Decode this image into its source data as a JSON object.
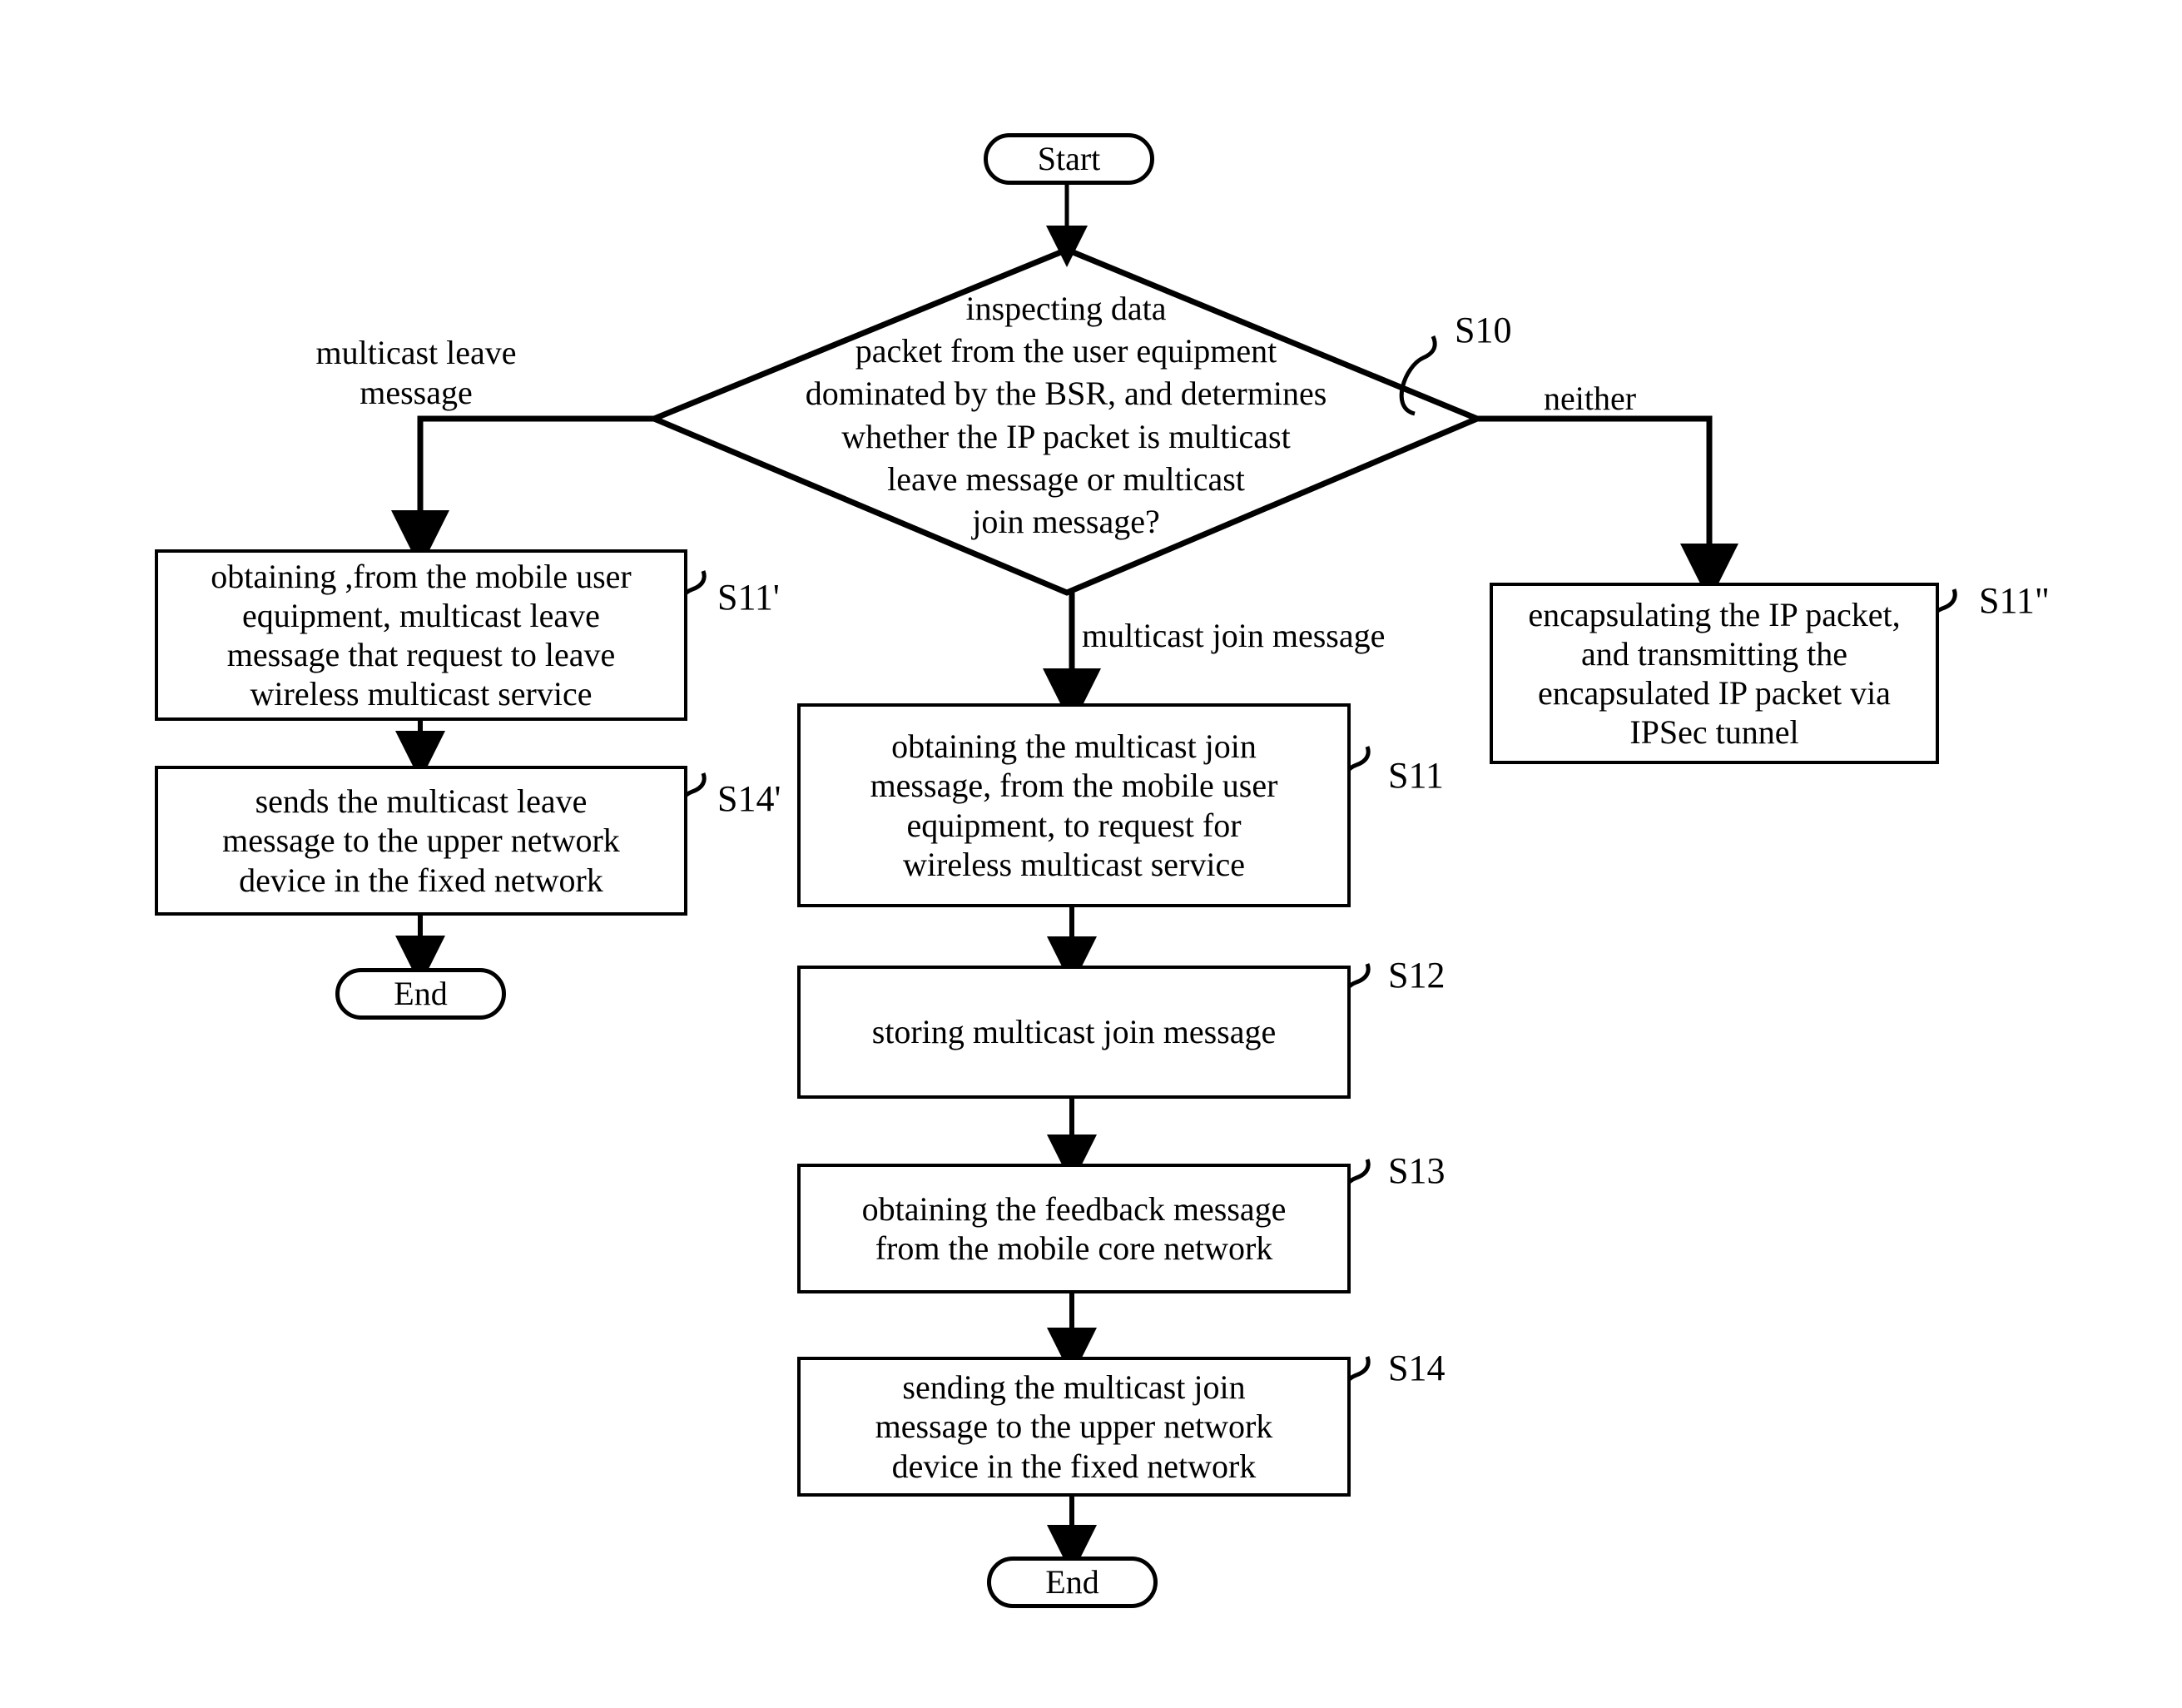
{
  "figure": {
    "type": "flowchart",
    "orientation": "top-down",
    "background_color": "#ffffff",
    "line_color": "#000000"
  },
  "nodes": {
    "start": {
      "label": "Start",
      "shape": "terminator"
    },
    "decision": {
      "shape": "diamond",
      "step_id": "S10",
      "lines": [
        "inspecting data",
        "packet from the user equipment",
        "dominated by the BSR, and determines",
        "whether the IP packet is multicast",
        "leave message or multicast",
        "join message?"
      ]
    },
    "left_1": {
      "shape": "process",
      "step_id": "S11'",
      "lines": [
        "obtaining ,from the mobile user",
        "equipment, multicast leave",
        "message that request to leave",
        "wireless multicast service"
      ]
    },
    "left_2": {
      "shape": "process",
      "step_id": "S14'",
      "lines": [
        "sends the multicast leave",
        "message to the upper network",
        "device in the fixed network"
      ]
    },
    "left_end": {
      "label": "End",
      "shape": "terminator"
    },
    "right_1": {
      "shape": "process",
      "step_id": "S11\"",
      "lines": [
        "encapsulating the IP packet,",
        "and transmitting the",
        "encapsulated IP packet via",
        "IPSec tunnel"
      ]
    },
    "center_1": {
      "shape": "process",
      "step_id": "S11",
      "lines": [
        "obtaining the multicast join",
        "message, from the mobile user",
        "equipment, to request for",
        "wireless multicast service"
      ]
    },
    "center_2": {
      "shape": "process",
      "step_id": "S12",
      "lines": [
        "storing multicast join message"
      ]
    },
    "center_3": {
      "shape": "process",
      "step_id": "S13",
      "lines": [
        "obtaining the feedback message",
        "from the mobile core network"
      ]
    },
    "center_4": {
      "shape": "process",
      "step_id": "S14",
      "lines": [
        "sending the multicast join",
        "message  to the upper network",
        "device in the fixed network"
      ]
    },
    "center_end": {
      "label": "End",
      "shape": "terminator"
    }
  },
  "edge_labels": {
    "left_branch": [
      "multicast leave",
      "message"
    ],
    "right_branch": "neither",
    "center_branch": "multicast join message"
  },
  "step_labels": {
    "s10": "S10",
    "s11_prime": "S11'",
    "s14_prime": "S14'",
    "s11_dprime": "S11\"",
    "s11": "S11",
    "s12": "S12",
    "s13": "S13",
    "s14": "S14"
  }
}
